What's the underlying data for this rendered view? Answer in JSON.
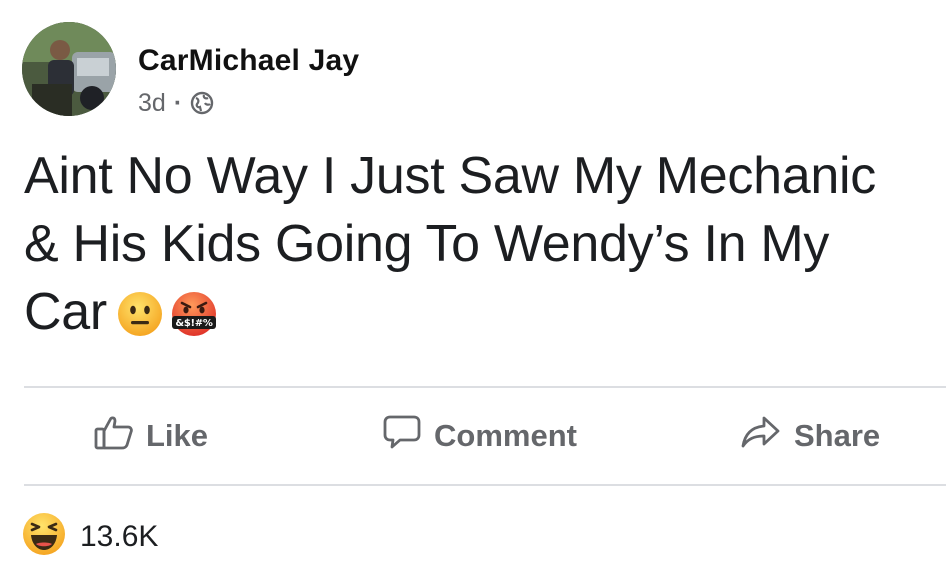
{
  "post": {
    "author": "CarMichael Jay",
    "time": "3d",
    "separator": "·",
    "audience_icon": "globe-icon",
    "text_lines": [
      "Aint No Way I Just Saw My Mechanic",
      "& His Kids Going To Wendy’s In My",
      "Car"
    ],
    "emojis": [
      "neutral-face-emoji",
      "cursing-face-emoji"
    ],
    "cursing_symbols": "&$!#%"
  },
  "actions": {
    "like": "Like",
    "comment": "Comment",
    "share": "Share"
  },
  "reactions": {
    "icon": "laughing-reaction-icon",
    "count": "13.6K"
  },
  "colors": {
    "text": "#1c1e21",
    "muted": "#65676b",
    "divider": "#dcdee2"
  }
}
